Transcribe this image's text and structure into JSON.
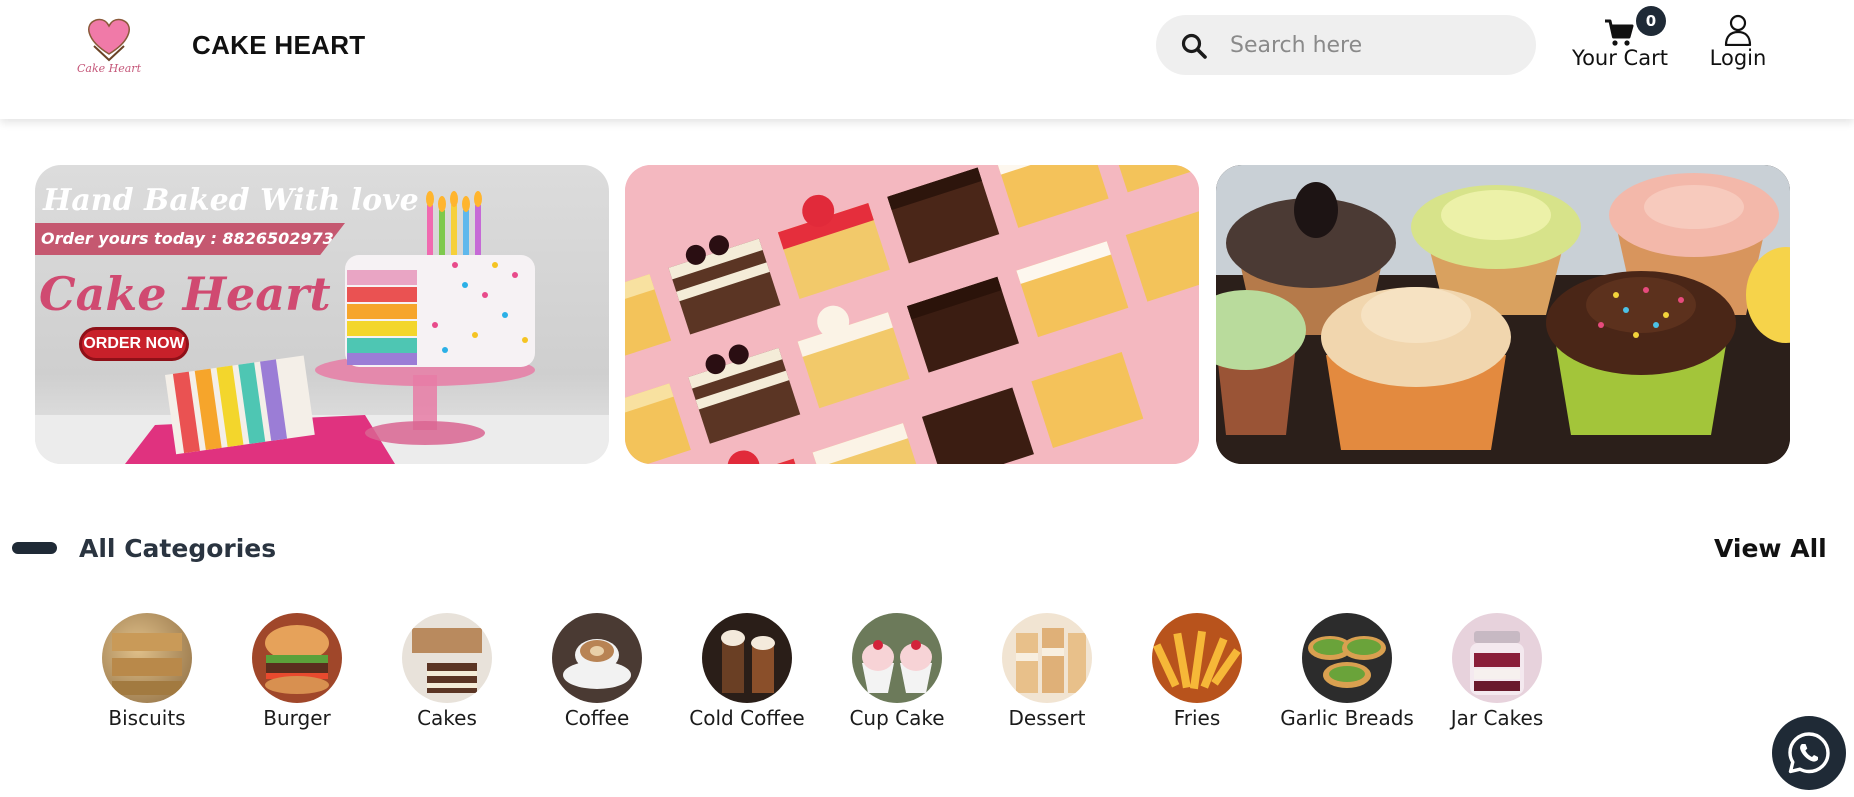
{
  "header": {
    "logo_text": "Cake Heart",
    "brand": "CAKE HEART",
    "search_placeholder": "Search here",
    "cart_count": "0",
    "cart_label": "Your Cart",
    "login_label": "Login"
  },
  "banners": [
    {
      "headline": "Hand Baked With love",
      "phone_line": "Order yours today : 8826502973",
      "name": "Cake Heart",
      "cta": "ORDER NOW"
    },
    {
      "alt": "pastries"
    },
    {
      "alt": "cupcakes"
    }
  ],
  "categories": {
    "title": "All Categories",
    "view_all": "View All",
    "items": [
      {
        "label": "Biscuits",
        "color": "#b08a55"
      },
      {
        "label": "Burger",
        "color": "#c9622e"
      },
      {
        "label": "Cakes",
        "color": "#8a5a3a"
      },
      {
        "label": "Coffee",
        "color": "#4a3a33"
      },
      {
        "label": "Cold Coffee",
        "color": "#3b2a22"
      },
      {
        "label": "Cup Cake",
        "color": "#c98a8f"
      },
      {
        "label": "Dessert",
        "color": "#d8b07a"
      },
      {
        "label": "Fries",
        "color": "#e8a22a"
      },
      {
        "label": "Garlic Breads",
        "color": "#8fa54a"
      },
      {
        "label": "Jar Cakes",
        "color": "#b77d8e"
      }
    ]
  },
  "colors": {
    "accent_dark": "#1f2a36",
    "banner_pink": "#d04a71"
  }
}
